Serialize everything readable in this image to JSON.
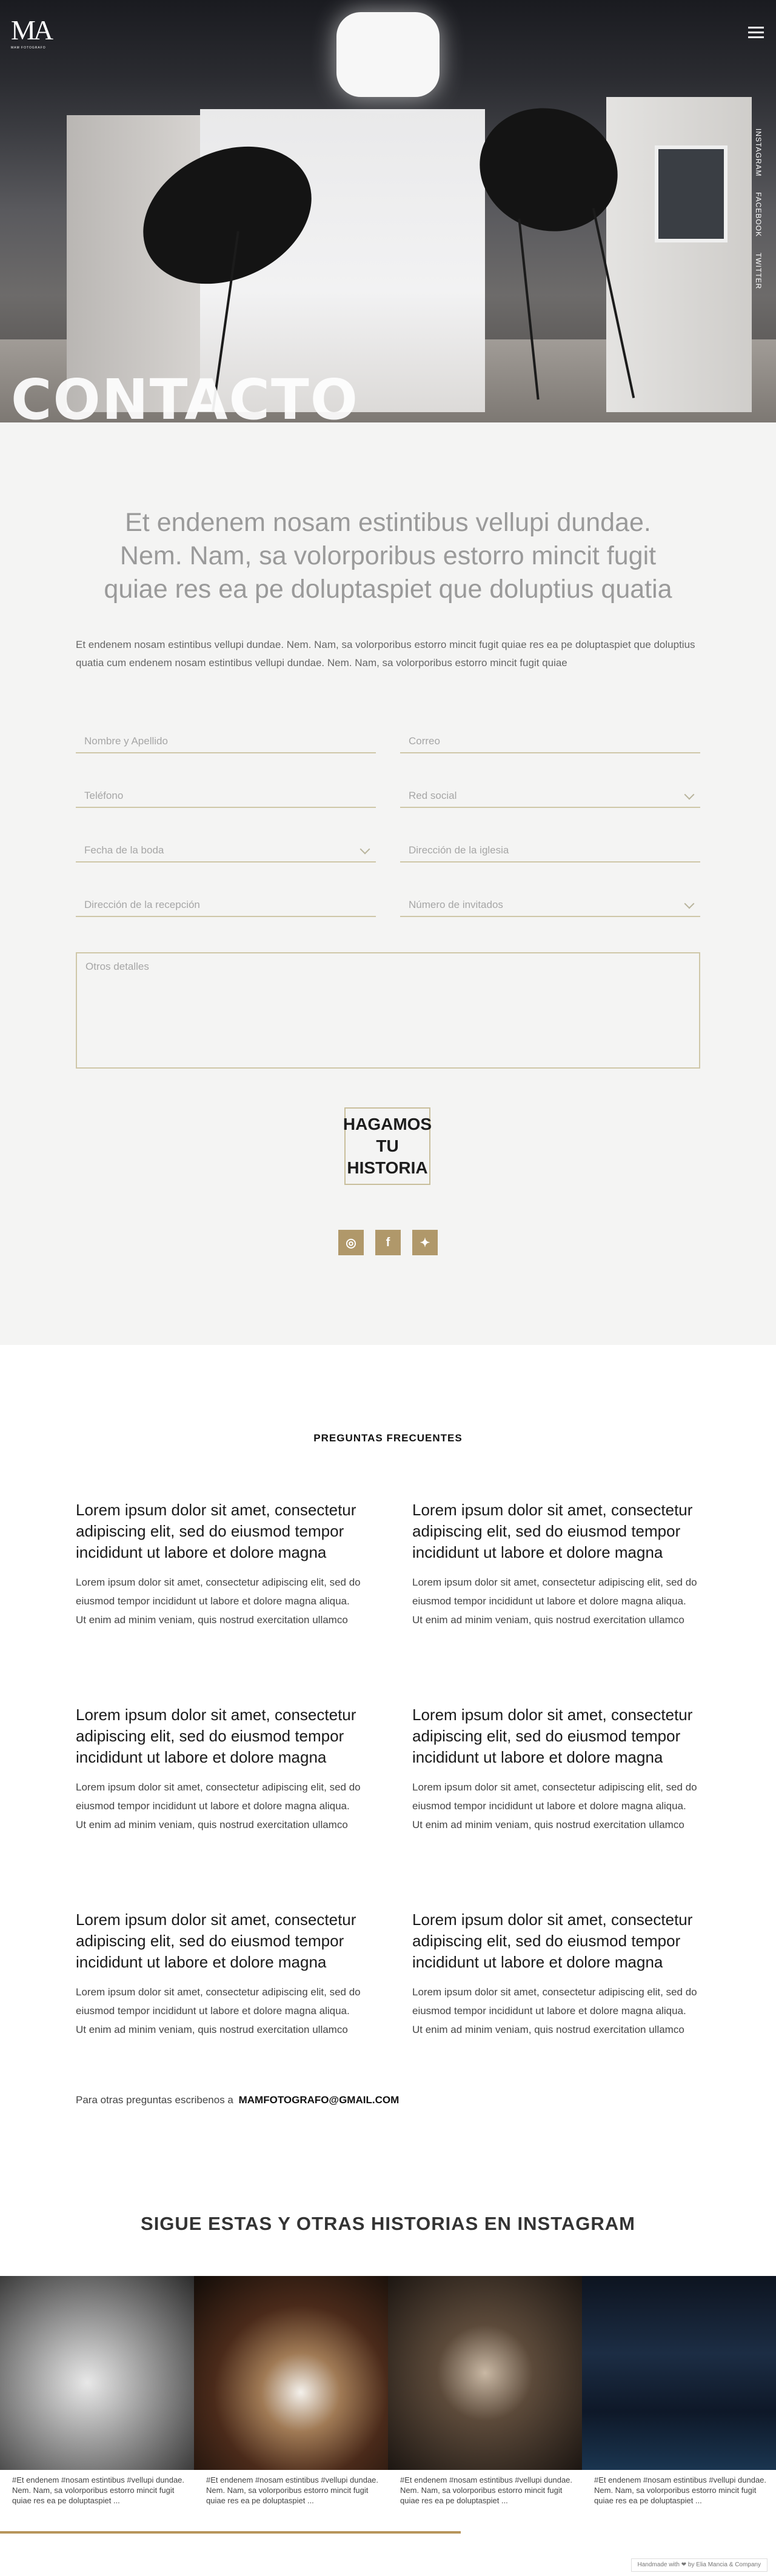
{
  "colors": {
    "accent": "#b0986a",
    "field_line": "#cfc7a8",
    "section_bg": "#f4f4f3"
  },
  "hero": {
    "logo_mark": "MA",
    "logo_sub": "MAM FOTOGRAFO",
    "title": "CONTACTO",
    "side_links": [
      "INSTAGRAM",
      "FACEBOOK",
      "TWITTER"
    ],
    "menu_icon": "hamburger-icon"
  },
  "contact": {
    "lead": "Et endenem nosam estintibus vellupi dundae. Nem. Nam, sa volorporibus estorro mincit fugit quiae res ea pe doluptaspiet que doluptius quatia",
    "paragraph": "Et endenem nosam estintibus vellupi dundae. Nem. Nam, sa volorporibus estorro mincit fugit quiae res ea pe doluptaspiet que doluptius quatia cum endenem nosam estintibus vellupi dundae. Nem. Nam, sa volorporibus estorro mincit fugit quiae",
    "fields": {
      "name": "Nombre y Apellido",
      "email": "Correo",
      "phone": "Teléfono",
      "social": "Red social",
      "wedding_date": "Fecha de la boda",
      "church": "Dirección de la iglesia",
      "reception": "Dirección de la recepción",
      "guests": "Número de invitados",
      "details": "Otros detalles"
    },
    "submit_label": "HAGAMOS TU HISTORIA",
    "social_icons": [
      "instagram-icon",
      "facebook-icon",
      "twitter-icon"
    ]
  },
  "faq": {
    "title": "PREGUNTAS FRECUENTES",
    "items": [
      {
        "q": "Lorem ipsum dolor sit amet, consectetur adipiscing elit, sed do eiusmod tempor incididunt ut labore et dolore magna",
        "a": "Lorem ipsum dolor sit amet, consectetur adipiscing elit, sed do eiusmod tempor incididunt ut labore et dolore magna aliqua. Ut enim ad minim veniam, quis nostrud exercitation ullamco"
      },
      {
        "q": "Lorem ipsum dolor sit amet, consectetur adipiscing elit, sed do eiusmod tempor incididunt ut labore et dolore magna",
        "a": "Lorem ipsum dolor sit amet, consectetur adipiscing elit, sed do eiusmod tempor incididunt ut labore et dolore magna aliqua. Ut enim ad minim veniam, quis nostrud exercitation ullamco"
      },
      {
        "q": "Lorem ipsum dolor sit amet, consectetur adipiscing elit, sed do eiusmod tempor incididunt ut labore et dolore magna",
        "a": "Lorem ipsum dolor sit amet, consectetur adipiscing elit, sed do eiusmod tempor incididunt ut labore et dolore magna aliqua. Ut enim ad minim veniam, quis nostrud exercitation ullamco"
      },
      {
        "q": "Lorem ipsum dolor sit amet, consectetur adipiscing elit, sed do eiusmod tempor incididunt ut labore et dolore magna",
        "a": "Lorem ipsum dolor sit amet, consectetur adipiscing elit, sed do eiusmod tempor incididunt ut labore et dolore magna aliqua. Ut enim ad minim veniam, quis nostrud exercitation ullamco"
      },
      {
        "q": "Lorem ipsum dolor sit amet, consectetur adipiscing elit, sed do eiusmod tempor incididunt ut labore et dolore magna",
        "a": "Lorem ipsum dolor sit amet, consectetur adipiscing elit, sed do eiusmod tempor incididunt ut labore et dolore magna aliqua. Ut enim ad minim veniam, quis nostrud exercitation ullamco"
      },
      {
        "q": "Lorem ipsum dolor sit amet, consectetur adipiscing elit, sed do eiusmod tempor incididunt ut labore et dolore magna",
        "a": "Lorem ipsum dolor sit amet, consectetur adipiscing elit, sed do eiusmod tempor incididunt ut labore et dolore magna aliqua. Ut enim ad minim veniam, quis nostrud exercitation ullamco"
      }
    ],
    "contact_prefix": "Para otras preguntas escribenos a",
    "contact_email": "MAMFOTOGRAFO@GMAIL.COM"
  },
  "instagram": {
    "title": "SIGUE ESTAS Y OTRAS HISTORIAS EN INSTAGRAM",
    "captions": [
      "#Et endenem #nosam estintibus #vellupi dundae. Nem. Nam, sa volorporibus estorro mincit fugit quiae res ea pe doluptaspiet ...",
      "#Et endenem #nosam estintibus #vellupi dundae. Nem. Nam, sa volorporibus estorro mincit fugit quiae res ea pe doluptaspiet ...",
      "#Et endenem #nosam estintibus #vellupi dundae. Nem. Nam, sa volorporibus estorro mincit fugit quiae res ea pe doluptaspiet ...",
      "#Et endenem #nosam estintibus #vellupi dundae. Nem. Nam, sa volorporibus estorro mincit fugit quiae res ea pe doluptaspiet ..."
    ],
    "badge": "Handmade with ❤ by Elia Mancia & Company"
  }
}
